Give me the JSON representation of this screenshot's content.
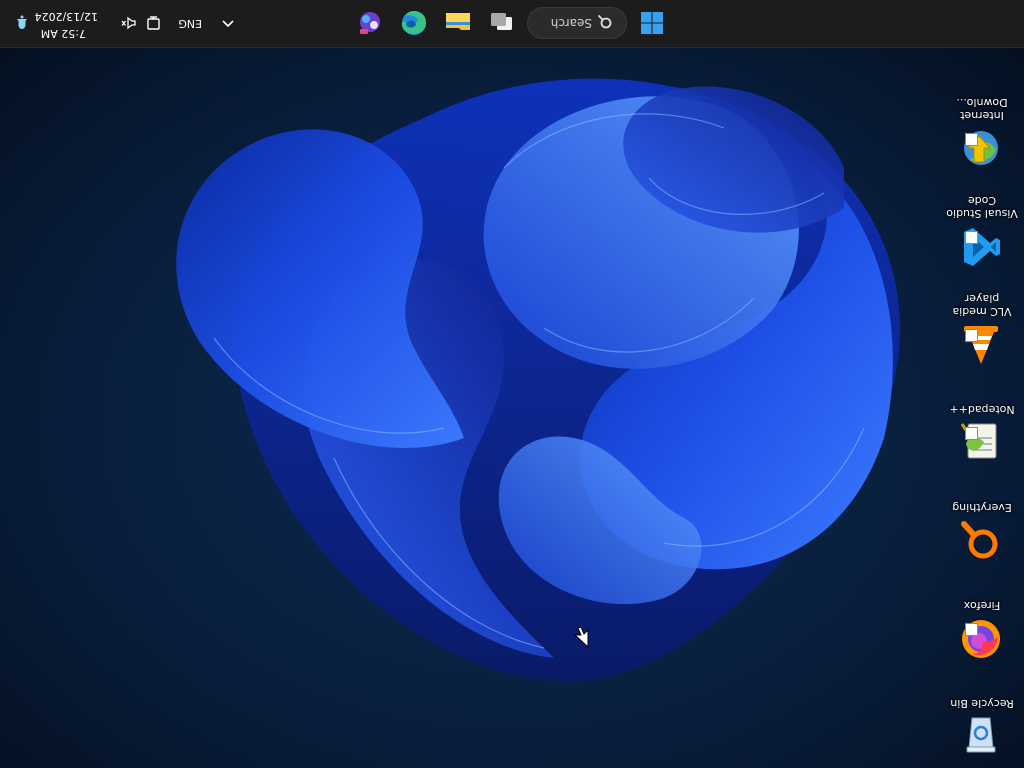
{
  "desktop": {
    "icons": [
      {
        "label": "Recycle Bin"
      },
      {
        "label": "Firefox"
      },
      {
        "label": "Everything"
      },
      {
        "label": "Notepad++"
      },
      {
        "label": "VLC media player"
      },
      {
        "label": "Visual Studio Code"
      },
      {
        "label": "Internet Downlo..."
      }
    ]
  },
  "taskbar": {
    "search_label": "Search",
    "language": "ENG",
    "time": "7:52 AM",
    "date": "12/13/2024",
    "apps": [
      "start-icon",
      "search-icon",
      "task-view-icon",
      "file-explorer-icon",
      "edge-icon",
      "app-icon"
    ]
  },
  "colors": {
    "taskbar_bg": "#1c1c1c",
    "wallpaper_bg": "#07162c",
    "bloom_blue": "#1f47e0"
  }
}
